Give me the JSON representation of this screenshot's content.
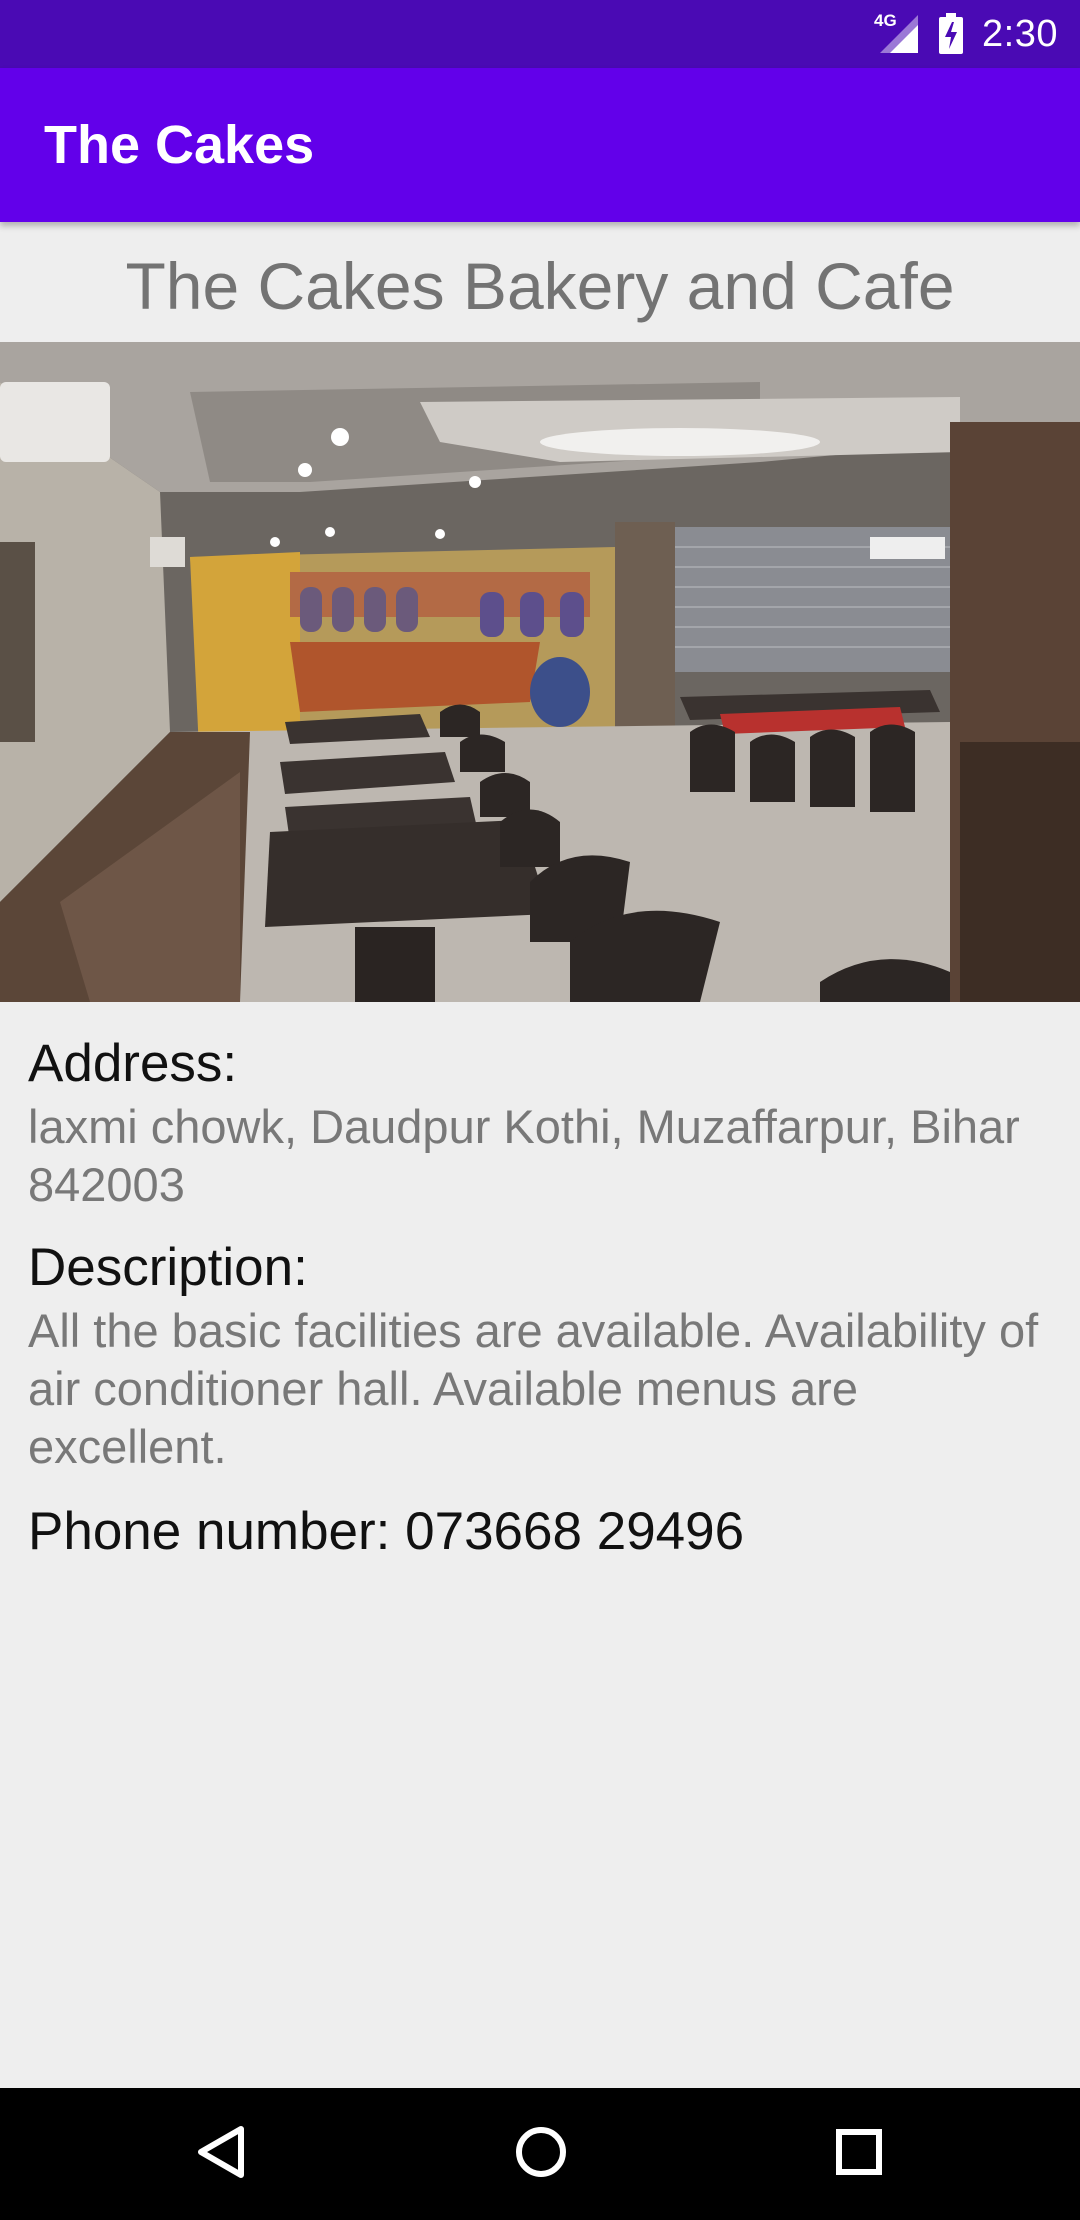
{
  "status_bar": {
    "network": "4G",
    "time": "2:30",
    "icons": [
      "signal-icon",
      "battery-charging-icon"
    ]
  },
  "app_bar": {
    "title": "The Cakes",
    "color": "#6200ea"
  },
  "place": {
    "name": "The Cakes Bakery and Cafe",
    "photo_icon": "restaurant-interior-photo",
    "address_label": "Address:",
    "address_value": "laxmi chowk, Daudpur Kothi, Muzaffarpur, Bihar 842003",
    "description_label": "Description:",
    "description_value": "All the basic facilities are available. Availability of air conditioner hall. Available menus are excellent.",
    "phone_text": "Phone number: 073668 29496"
  },
  "nav_bar": {
    "icons": [
      "back-icon",
      "home-icon",
      "recents-icon"
    ]
  }
}
